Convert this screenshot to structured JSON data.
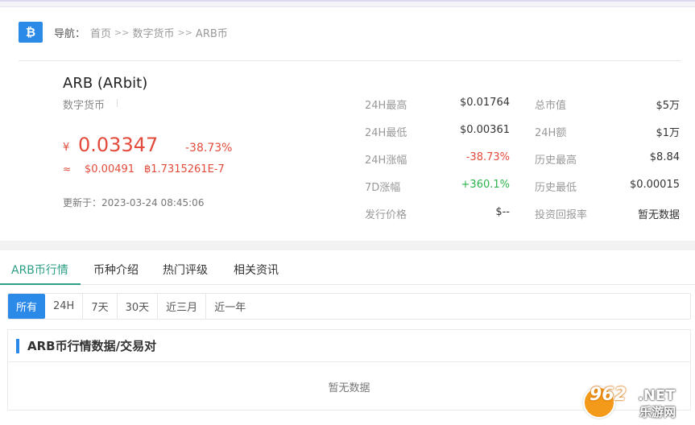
{
  "breadcrumb": {
    "label": "导航：",
    "items": [
      "首页",
      "数字货币",
      "ARB币"
    ],
    "separator": ">>"
  },
  "coin": {
    "icon": "bitcoin-logo-icon",
    "icon_glyph": "₿",
    "name": "ARB (ARbit)",
    "category": "数字货币",
    "cny_symbol": "¥",
    "cny_price": "0.03347",
    "change": "-38.73%",
    "approx_symbol": "≈",
    "usd_price": "$0.00491",
    "btc_price": "฿1.7315261E-7",
    "updated": "更新于：2023-03-24 08:45:06"
  },
  "stats_left": [
    {
      "label": "24H最高",
      "value": "$0.01764"
    },
    {
      "label": "24H最低",
      "value": "$0.00361"
    },
    {
      "label": "24H涨幅",
      "value": "-38.73%"
    },
    {
      "label": "7D涨幅",
      "value": "+360.1%"
    },
    {
      "label": "发行价格",
      "value": "$--"
    }
  ],
  "stats_right": [
    {
      "label": "总市值",
      "value": "$5万"
    },
    {
      "label": "24H额",
      "value": "$1万"
    },
    {
      "label": "历史最高",
      "value": "$8.84"
    },
    {
      "label": "历史最低",
      "value": "$0.00015"
    },
    {
      "label": "投资回报率",
      "value": "暂无数据"
    }
  ],
  "tabs": [
    "ARB币行情",
    "币种介绍",
    "热门评级",
    "相关资讯"
  ],
  "active_tab": "ARB币行情",
  "ranges": [
    "所有",
    "24H",
    "7天",
    "30天",
    "近三月",
    "近一年"
  ],
  "active_range": "所有",
  "panel": {
    "title": "ARB币行情数据/交易对",
    "empty_text": "暂无数据"
  },
  "watermark": {
    "brand": "962",
    "net": ".NET",
    "cn": "乐游网"
  },
  "colors": {
    "accent_blue": "#2b8ae8",
    "tab_green": "#2b9f86",
    "down_red": "#e24b3b",
    "up_green": "#2bb24c"
  }
}
